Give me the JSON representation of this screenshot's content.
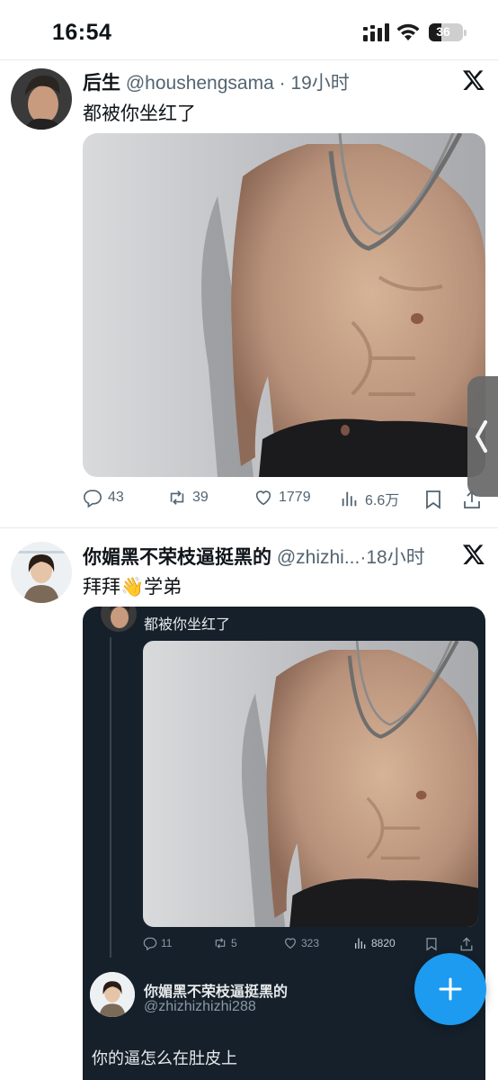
{
  "status_bar": {
    "time": "16:54",
    "battery": "36",
    "battery_level": 0.36
  },
  "tweets": [
    {
      "name": "后生",
      "handle": "@houshengsama",
      "sep": " · ",
      "time": "19小时",
      "text": "都被你坐红了",
      "stats": {
        "replies": "43",
        "retweets": "39",
        "likes": "1779",
        "views": "6.6万"
      }
    },
    {
      "name": "你媚黑不荣枝逼挺黑的",
      "handle": "@zhizhi...",
      "sep": "·",
      "time": "18小时",
      "text": "拜拜👋学弟",
      "quote": {
        "text": "都被你坐红了",
        "stats": {
          "replies": "11",
          "retweets": "5",
          "likes": "323",
          "views": "8820"
        },
        "reply_name": "你媚黑不荣枝逼挺黑的",
        "reply_handle": "@zhizhizhizhi288",
        "reply_text": "你的逼怎么在肚皮上"
      }
    }
  ],
  "icons": {
    "x_logo": "x-logo-icon",
    "reply": "reply-icon",
    "retweet": "retweet-icon",
    "like": "heart-icon",
    "views": "views-icon",
    "bookmark": "bookmark-icon",
    "share": "share-icon",
    "compose": "plus-icon",
    "side_handle": "chevron-left-icon"
  },
  "colors": {
    "accent": "#1d9bf0",
    "dark_card": "#15202b",
    "muted_text": "#536471"
  }
}
